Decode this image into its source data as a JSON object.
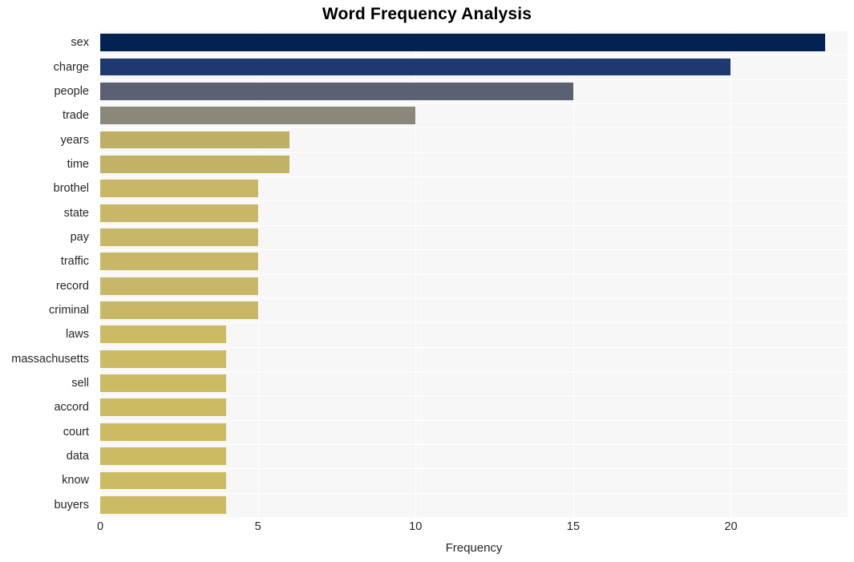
{
  "chart_data": {
    "type": "bar",
    "orientation": "horizontal",
    "title": "Word Frequency Analysis",
    "xlabel": "Frequency",
    "ylabel": "",
    "xlim": [
      0,
      23.7
    ],
    "ylim": [
      0,
      20
    ],
    "grid": true,
    "legend": false,
    "xticks": [
      "0",
      "5",
      "10",
      "15",
      "20"
    ],
    "xtick_values": [
      0,
      5,
      10,
      15,
      20
    ],
    "categories": [
      "sex",
      "charge",
      "people",
      "trade",
      "years",
      "time",
      "brothel",
      "state",
      "pay",
      "traffic",
      "record",
      "criminal",
      "laws",
      "massachusetts",
      "sell",
      "accord",
      "court",
      "data",
      "know",
      "buyers"
    ],
    "values": [
      23,
      20,
      15,
      10,
      6,
      6,
      5,
      5,
      5,
      5,
      5,
      5,
      4,
      4,
      4,
      4,
      4,
      4,
      4,
      4
    ],
    "bar_colors": [
      "#022251",
      "#1e3870",
      "#5b6073",
      "#8a887b",
      "#bfae66",
      "#c2b268",
      "#c7b767",
      "#c7b767",
      "#c7b767",
      "#c7b767",
      "#c7b767",
      "#c7b767",
      "#ccbb63",
      "#ccbb63",
      "#ccbb63",
      "#ccbb63",
      "#ccbb63",
      "#ccbb63",
      "#ccbb63",
      "#ccbb63"
    ]
  },
  "style": {
    "plot_background": "#f7f7f7",
    "figure_background": "#ffffff",
    "gridline_color": "#ffffff",
    "tick_label_color": "#262626",
    "title_color": "#000000"
  }
}
